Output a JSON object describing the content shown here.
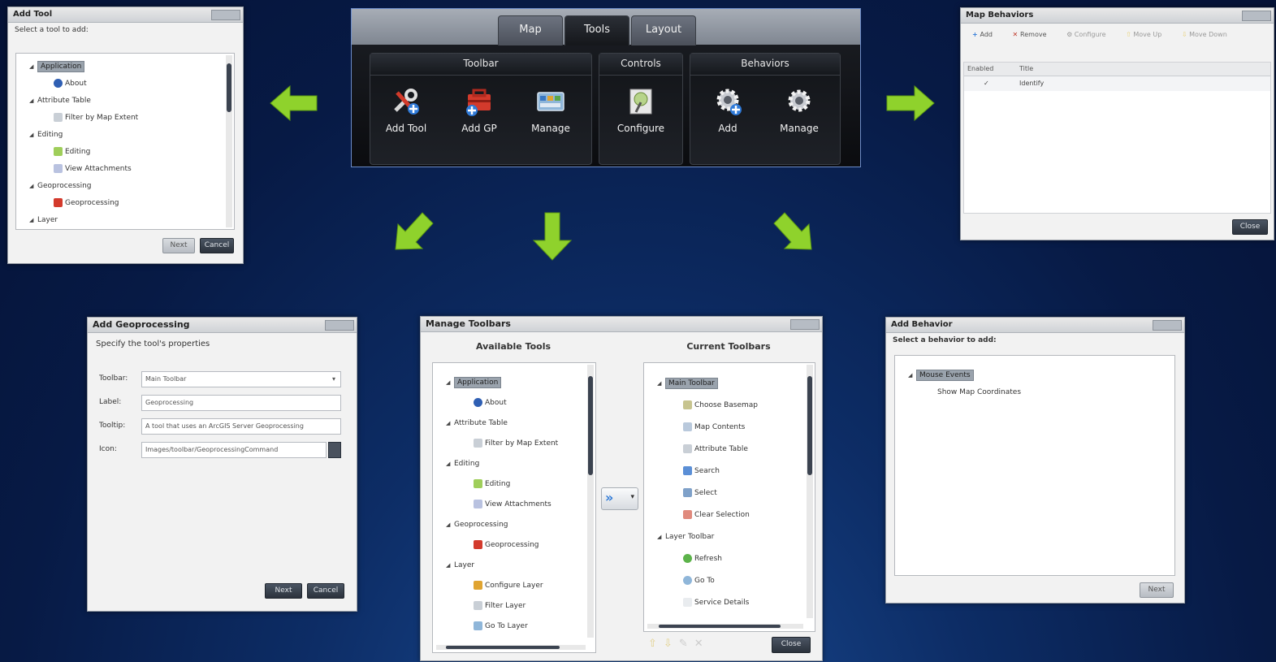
{
  "ribbon": {
    "tabs": [
      "Map",
      "Tools",
      "Layout"
    ],
    "groups": {
      "toolbar": {
        "title": "Toolbar",
        "buttons": [
          "Add Tool",
          "Add GP",
          "Manage"
        ]
      },
      "controls": {
        "title": "Controls",
        "buttons": [
          "Configure"
        ]
      },
      "behaviors": {
        "title": "Behaviors",
        "buttons": [
          "Add",
          "Manage"
        ]
      }
    }
  },
  "add_tool": {
    "title": "Add Tool",
    "subtitle": "Select a tool to add:",
    "items": [
      "Application",
      "About",
      "Attribute Table",
      "Filter by Map Extent",
      "Editing",
      "Editing",
      "View Attachments",
      "Geoprocessing",
      "Geoprocessing",
      "Layer"
    ],
    "buttons": [
      "Next",
      "Cancel"
    ]
  },
  "map_behaviors": {
    "title": "Map Behaviors",
    "toolbar": [
      "Add",
      "Remove",
      "Configure",
      "Move Up",
      "Move Down"
    ],
    "columns": [
      "Enabled",
      "Title"
    ],
    "rows": [
      {
        "enabled": "✓",
        "title": "Identify"
      }
    ],
    "close": "Close"
  },
  "add_gp": {
    "title": "Add Geoprocessing",
    "subtitle": "Specify the tool's properties",
    "fields": [
      {
        "label": "Toolbar:",
        "value": "Main Toolbar"
      },
      {
        "label": "Label:",
        "value": "Geoprocessing"
      },
      {
        "label": "Tooltip:",
        "value": "A tool that uses an ArcGIS Server Geoprocessing"
      },
      {
        "label": "Icon:",
        "value": "Images/toolbar/GeoprocessingCommand"
      }
    ],
    "buttons": [
      "Next",
      "Cancel"
    ]
  },
  "manage_toolbars": {
    "title": "Manage Toolbars",
    "available_header": "Available Tools",
    "current_header": "Current Toolbars",
    "available": [
      "Application",
      "About",
      "Attribute Table",
      "Filter by Map Extent",
      "Editing",
      "Editing",
      "View Attachments",
      "Geoprocessing",
      "Geoprocessing",
      "Layer",
      "Configure Layer",
      "Filter Layer",
      "Go To Layer"
    ],
    "current": [
      "Main Toolbar",
      "Choose Basemap",
      "Map Contents",
      "Attribute Table",
      "Search",
      "Select",
      "Clear Selection",
      "Layer Toolbar",
      "Refresh",
      "Go To",
      "Service Details"
    ],
    "close": "Close"
  },
  "add_behavior": {
    "title": "Add Behavior",
    "subtitle": "Select a behavior to add:",
    "items": [
      "Mouse Events",
      "Show Map Coordinates"
    ],
    "button": "Next"
  },
  "colors": {
    "arrow": "#8fd22c",
    "accent": "#6b8bc8"
  }
}
